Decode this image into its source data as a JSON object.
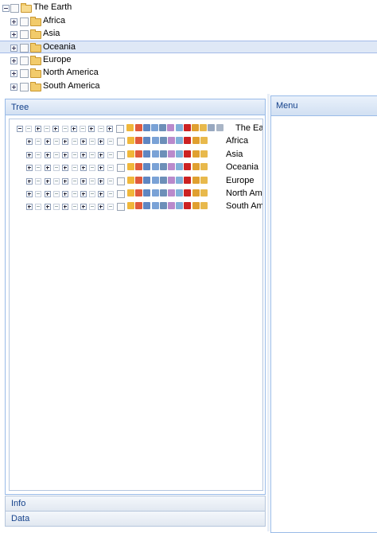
{
  "top_tree": {
    "root": "The Earth",
    "children": [
      "Africa",
      "Asia",
      "Oceania",
      "Europe",
      "North America",
      "South America"
    ],
    "selected": "Oceania"
  },
  "tree_panel": {
    "title": "Tree",
    "root": "The Ear",
    "children": [
      "Africa",
      "Asia",
      "Oceania",
      "Europe",
      "North Ame",
      "South Ame"
    ]
  },
  "accordion": {
    "info": "Info",
    "data": "Data"
  },
  "menu_panel": {
    "title": "Menu"
  },
  "scroll": {
    "grip": "|||"
  },
  "icon_colors": [
    "#f0b73a",
    "#e05a3c",
    "#5f86c2",
    "#7aa2d6",
    "#6d8fb8",
    "#b98acb",
    "#7fb1d9",
    "#cc2222",
    "#e0a030",
    "#e8b94c",
    "#98a8c0",
    "#a9b5c6"
  ]
}
